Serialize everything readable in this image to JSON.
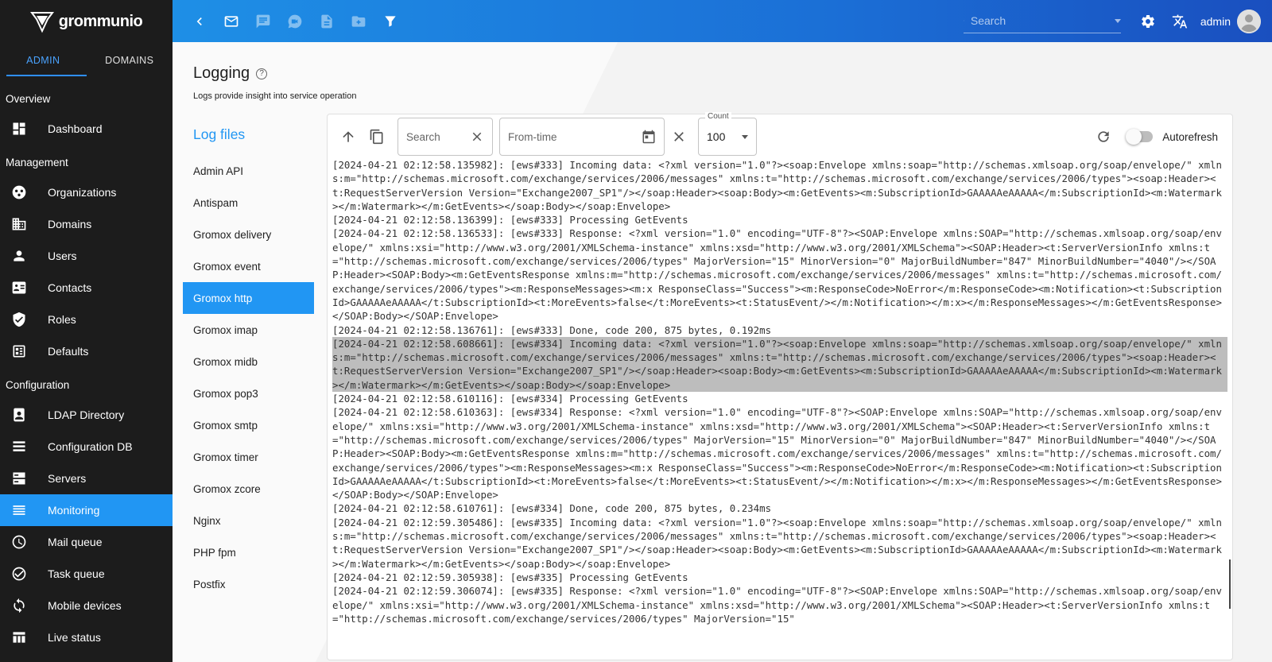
{
  "app": {
    "brand": "grommunio"
  },
  "sidebar": {
    "tabs": [
      {
        "label": "ADMIN",
        "active": true
      },
      {
        "label": "DOMAINS",
        "active": false
      }
    ],
    "sections": {
      "overview": "Overview",
      "management": "Management",
      "configuration": "Configuration"
    },
    "items": {
      "dashboard": "Dashboard",
      "organizations": "Organizations",
      "domains": "Domains",
      "users": "Users",
      "contacts": "Contacts",
      "roles": "Roles",
      "defaults": "Defaults",
      "ldap": "LDAP Directory",
      "configdb": "Configuration DB",
      "servers": "Servers",
      "monitoring": "Monitoring",
      "mailqueue": "Mail queue",
      "taskqueue": "Task queue",
      "mobile": "Mobile devices",
      "livestatus": "Live status"
    }
  },
  "topbar": {
    "search_placeholder": "Search",
    "user": "admin"
  },
  "page": {
    "title": "Logging",
    "subtitle": "Logs provide insight into service operation"
  },
  "logfiles": {
    "title": "Log files",
    "items": [
      "Admin API",
      "Antispam",
      "Gromox delivery",
      "Gromox event",
      "Gromox http",
      "Gromox imap",
      "Gromox midb",
      "Gromox pop3",
      "Gromox smtp",
      "Gromox timer",
      "Gromox zcore",
      "Nginx",
      "PHP fpm",
      "Postfix"
    ],
    "active_index": 4
  },
  "toolbar": {
    "search_placeholder": "Search",
    "fromtime_placeholder": "From-time",
    "count_label": "Count",
    "count_value": "100",
    "autorefresh_label": "Autorefresh"
  },
  "log": {
    "lines": [
      "[2024-04-21 02:12:58.135982]: [ews#333] Incoming data: <?xml version=\"1.0\"?><soap:Envelope xmlns:soap=\"http://schemas.xmlsoap.org/soap/envelope/\" xmlns:m=\"http://schemas.microsoft.com/exchange/services/2006/messages\" xmlns:t=\"http://schemas.microsoft.com/exchange/services/2006/types\"><soap:Header><t:RequestServerVersion Version=\"Exchange2007_SP1\"/></soap:Header><soap:Body><m:GetEvents><m:SubscriptionId>GAAAAAeAAAAA</m:SubscriptionId><m:Watermark></m:Watermark></m:GetEvents></soap:Body></soap:Envelope>",
      "[2024-04-21 02:12:58.136399]: [ews#333] Processing GetEvents",
      "[2024-04-21 02:12:58.136533]: [ews#333] Response: <?xml version=\"1.0\" encoding=\"UTF-8\"?><SOAP:Envelope xmlns:SOAP=\"http://schemas.xmlsoap.org/soap/envelope/\" xmlns:xsi=\"http://www.w3.org/2001/XMLSchema-instance\" xmlns:xsd=\"http://www.w3.org/2001/XMLSchema\"><SOAP:Header><t:ServerVersionInfo xmlns:t=\"http://schemas.microsoft.com/exchange/services/2006/types\" MajorVersion=\"15\" MinorVersion=\"0\" MajorBuildNumber=\"847\" MinorBuildNumber=\"4040\"/></SOAP:Header><SOAP:Body><m:GetEventsResponse xmlns:m=\"http://schemas.microsoft.com/exchange/services/2006/messages\" xmlns:t=\"http://schemas.microsoft.com/exchange/services/2006/types\"><m:ResponseMessages><m:x ResponseClass=\"Success\"><m:ResponseCode>NoError</m:ResponseCode><m:Notification><t:SubscriptionId>GAAAAAeAAAAA</t:SubscriptionId><t:MoreEvents>false</t:MoreEvents><t:StatusEvent/></m:Notification></m:x></m:ResponseMessages></m:GetEventsResponse></SOAP:Body></SOAP:Envelope>",
      "[2024-04-21 02:12:58.136761]: [ews#333] Done, code 200, 875 bytes, 0.192ms",
      "[2024-04-21 02:12:58.608661]: [ews#334] Incoming data: <?xml version=\"1.0\"?><soap:Envelope xmlns:soap=\"http://schemas.xmlsoap.org/soap/envelope/\" xmlns:m=\"http://schemas.microsoft.com/exchange/services/2006/messages\" xmlns:t=\"http://schemas.microsoft.com/exchange/services/2006/types\"><soap:Header><t:RequestServerVersion Version=\"Exchange2007_SP1\"/></soap:Header><soap:Body><m:GetEvents><m:SubscriptionId>GAAAAAeAAAAA</m:SubscriptionId><m:Watermark></m:Watermark></m:GetEvents></soap:Body></soap:Envelope>",
      "[2024-04-21 02:12:58.610116]: [ews#334] Processing GetEvents",
      "[2024-04-21 02:12:58.610363]: [ews#334] Response: <?xml version=\"1.0\" encoding=\"UTF-8\"?><SOAP:Envelope xmlns:SOAP=\"http://schemas.xmlsoap.org/soap/envelope/\" xmlns:xsi=\"http://www.w3.org/2001/XMLSchema-instance\" xmlns:xsd=\"http://www.w3.org/2001/XMLSchema\"><SOAP:Header><t:ServerVersionInfo xmlns:t=\"http://schemas.microsoft.com/exchange/services/2006/types\" MajorVersion=\"15\" MinorVersion=\"0\" MajorBuildNumber=\"847\" MinorBuildNumber=\"4040\"/></SOAP:Header><SOAP:Body><m:GetEventsResponse xmlns:m=\"http://schemas.microsoft.com/exchange/services/2006/messages\" xmlns:t=\"http://schemas.microsoft.com/exchange/services/2006/types\"><m:ResponseMessages><m:x ResponseClass=\"Success\"><m:ResponseCode>NoError</m:ResponseCode><m:Notification><t:SubscriptionId>GAAAAAeAAAAA</t:SubscriptionId><t:MoreEvents>false</t:MoreEvents><t:StatusEvent/></m:Notification></m:x></m:ResponseMessages></m:GetEventsResponse></SOAP:Body></SOAP:Envelope>",
      "[2024-04-21 02:12:58.610761]: [ews#334] Done, code 200, 875 bytes, 0.234ms",
      "[2024-04-21 02:12:59.305486]: [ews#335] Incoming data: <?xml version=\"1.0\"?><soap:Envelope xmlns:soap=\"http://schemas.xmlsoap.org/soap/envelope/\" xmlns:m=\"http://schemas.microsoft.com/exchange/services/2006/messages\" xmlns:t=\"http://schemas.microsoft.com/exchange/services/2006/types\"><soap:Header><t:RequestServerVersion Version=\"Exchange2007_SP1\"/></soap:Header><soap:Body><m:GetEvents><m:SubscriptionId>GAAAAAeAAAAA</m:SubscriptionId><m:Watermark></m:Watermark></m:GetEvents></soap:Body></soap:Envelope>",
      "[2024-04-21 02:12:59.305938]: [ews#335] Processing GetEvents",
      "[2024-04-21 02:12:59.306074]: [ews#335] Response: <?xml version=\"1.0\" encoding=\"UTF-8\"?><SOAP:Envelope xmlns:SOAP=\"http://schemas.xmlsoap.org/soap/envelope/\" xmlns:xsi=\"http://www.w3.org/2001/XMLSchema-instance\" xmlns:xsd=\"http://www.w3.org/2001/XMLSchema\"><SOAP:Header><t:ServerVersionInfo xmlns:t=\"http://schemas.microsoft.com/exchange/services/2006/types\" MajorVersion=\"15\""
    ],
    "highlight_index": 4
  },
  "colors": {
    "accent": "#2196f3",
    "sidebar_bg": "#1c1c1c",
    "highlight": "#bdbdbd"
  }
}
